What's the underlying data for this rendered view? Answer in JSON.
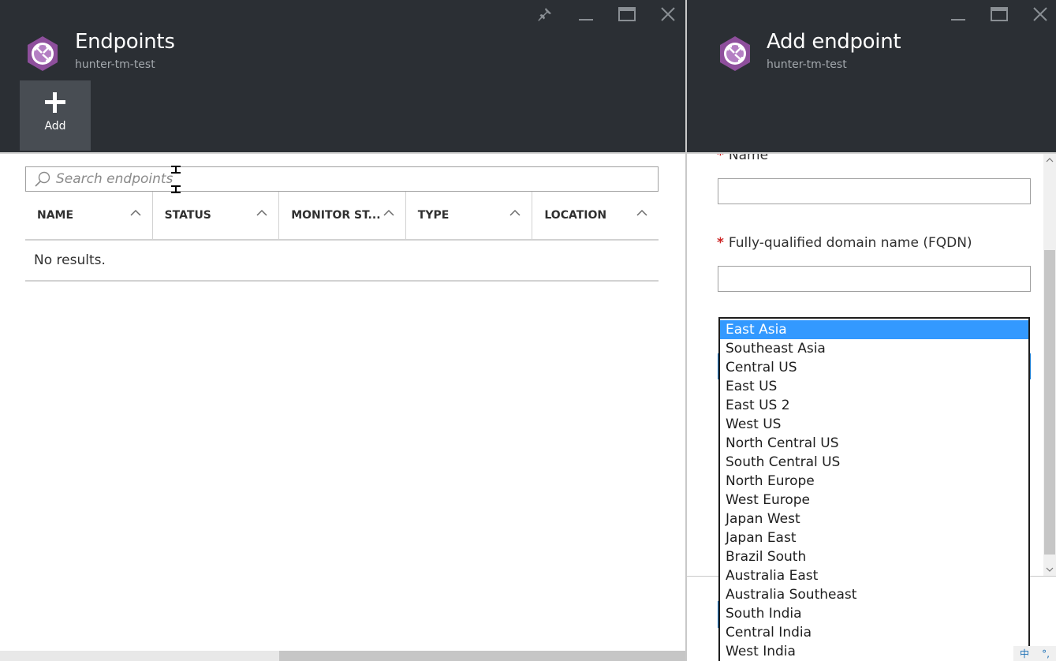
{
  "endpoints_blade": {
    "title": "Endpoints",
    "subtitle": "hunter-tm-test",
    "commands": {
      "add_label": "Add"
    },
    "search": {
      "placeholder": "Search endpoints",
      "value": ""
    },
    "columns": [
      "NAME",
      "STATUS",
      "MONITOR ST...",
      "TYPE",
      "LOCATION"
    ],
    "empty_text": "No results."
  },
  "add_endpoint_blade": {
    "title": "Add endpoint",
    "subtitle": "hunter-tm-test",
    "fields": {
      "name_label": "Name",
      "name_value": "",
      "fqdn_label": "Fully-qualified domain name (FQDN)",
      "fqdn_value": "",
      "required_marker": "*"
    },
    "location_dropdown": {
      "selected": "East Asia",
      "options": [
        "East Asia",
        "Southeast Asia",
        "Central US",
        "East US",
        "East US 2",
        "West US",
        "North Central US",
        "South Central US",
        "North Europe",
        "West Europe",
        "Japan West",
        "Japan East",
        "Brazil South",
        "Australia East",
        "Australia Southeast",
        "South India",
        "Central India",
        "West India"
      ]
    }
  },
  "ime_indicator": {
    "lang": "中",
    "punct": "°,"
  },
  "icons": {
    "blade_icon": "traffic-manager-icon",
    "pin": "pin-icon",
    "minimize": "minimize-icon",
    "maximize": "maximize-icon",
    "close": "close-icon",
    "search": "search-icon",
    "sort": "chevron-up-icon"
  },
  "colors": {
    "header_bg": "#2b2f34",
    "command_bg": "#484d53",
    "accent": "#1a7bcf",
    "selected_option": "#3399ff",
    "required": "#cc2222",
    "icon_purple": "#8e4f9c"
  }
}
